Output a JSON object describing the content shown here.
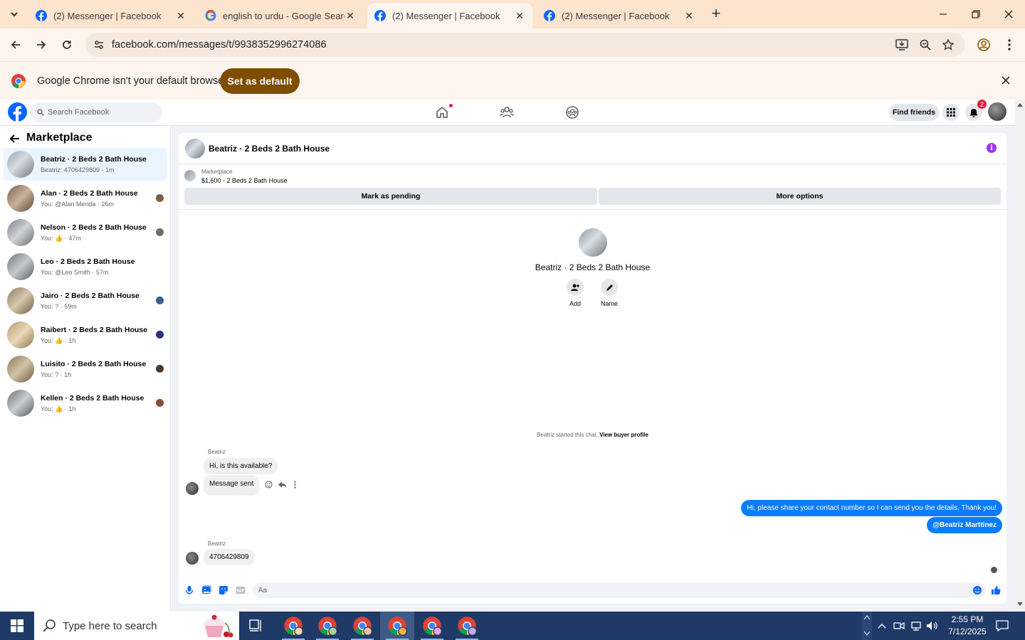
{
  "browser": {
    "tabs": [
      {
        "title": "(2) Messenger | Facebook",
        "icon": "facebook-icon",
        "active": false
      },
      {
        "title": "english to urdu - Google Search",
        "icon": "google-icon",
        "active": false
      },
      {
        "title": "(2) Messenger | Facebook",
        "icon": "facebook-icon",
        "active": true
      },
      {
        "title": "(2) Messenger | Facebook",
        "icon": "facebook-icon",
        "active": false
      }
    ],
    "url": "facebook.com/messages/t/9938352996274086",
    "infobar": {
      "message": "Google Chrome isn't your default browser",
      "button": "Set as default"
    }
  },
  "facebook": {
    "search_placeholder": "Search Facebook",
    "find_friends": "Find friends",
    "notification_count": "2"
  },
  "sidebar": {
    "title": "Marketplace",
    "conversations": [
      {
        "name": "Beatriz · 2 Beds 2 Bath House",
        "preview": "Beatriz: 4706429809 · 1m",
        "active": true,
        "seen_color": ""
      },
      {
        "name": "Alan · 2 Beds 2 Bath House",
        "preview": "You: @Alan Merida · 26m",
        "active": false,
        "seen_color": "#7a5a48"
      },
      {
        "name": "Nelson · 2 Beds 2 Bath House",
        "preview": "You: 👍 · 47m",
        "active": false,
        "seen_color": "#6d6f6a"
      },
      {
        "name": "Leo · 2 Beds 2 Bath House",
        "preview": "You: @Leo Smith · 57m",
        "active": false,
        "seen_color": ""
      },
      {
        "name": "Jairo · 2 Beds 2 Bath House",
        "preview": "You: ? · 59m",
        "active": false,
        "seen_color": "#3b5f8c"
      },
      {
        "name": "Raibert · 2 Beds 2 Bath House",
        "preview": "You: 👍 · 1h",
        "active": false,
        "seen_color": "#2a2f8a"
      },
      {
        "name": "Luisito · 2 Beds 2 Bath House",
        "preview": "You: ? · 1h",
        "active": false,
        "seen_color": "#4a3a30"
      },
      {
        "name": "Kellen · 2 Beds 2 Bath House",
        "preview": "You: 👍 · 1h",
        "active": false,
        "seen_color": "#8a4a40"
      }
    ]
  },
  "chat": {
    "title": "Beatriz · 2 Beds 2 Bath House",
    "listing_label": "Marketplace",
    "listing_price": "$1,600 - 2 Beds 2 Bath House",
    "mark_pending": "Mark as pending",
    "more_options": "More options",
    "center_name": "Beatriz · 2 Beds 2 Bath House",
    "add_label": "Add",
    "name_label": "Name",
    "started_text": "Beatriz started this chat.",
    "view_buyer": "View buyer profile",
    "sender_1": "Beatriz",
    "msg_1": "Hi, is this available?",
    "msg_2": "Message sent",
    "out_1": "Hi, please share your contact number so I can send you the details. Thank you!",
    "out_2": "@Beatriz Marttinez",
    "sender_2": "Beatriz",
    "msg_3": "4706429809",
    "input_placeholder": "Aa"
  },
  "taskbar": {
    "search_placeholder": "Type here to search",
    "time": "2:55 PM",
    "date": "7/12/2025"
  },
  "colors": {
    "accent": "#0a7cff",
    "facebook_blue": "#0866ff",
    "tab_strip": "#fde4cf",
    "chrome_button": "#7f4d00",
    "taskbar": "#1f3a66"
  }
}
